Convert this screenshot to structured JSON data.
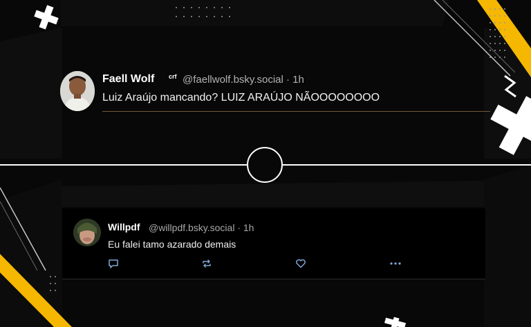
{
  "post_main": {
    "author": "Faell Wolf",
    "badge": "crf",
    "handle_time": "@faellwolf.bsky.social · 1h",
    "text": "Luiz Araújo mancando? LUIZ ARAÚJO NÃOOOOOOOO"
  },
  "post_reply": {
    "author": "Willpdf",
    "handle_time": "@willpdf.bsky.social · 1h",
    "text": "Eu falei tamo azarado demais",
    "actions": [
      "reply-icon",
      "repost-icon",
      "like-icon",
      "more-icon"
    ]
  },
  "colors": {
    "background": "#080808",
    "accent_yellow": "#f5b700",
    "divider": "#ffffff"
  }
}
